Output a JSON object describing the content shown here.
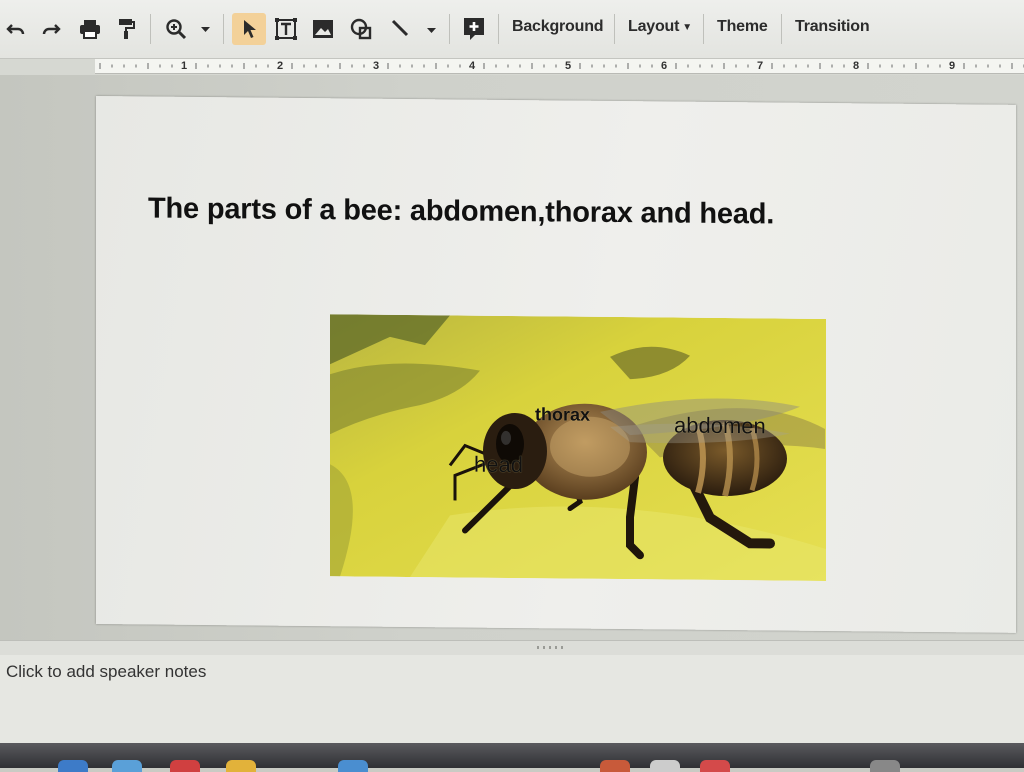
{
  "toolbar": {
    "icons": [
      "undo-icon",
      "redo-icon",
      "print-icon",
      "paint-format-icon",
      "zoom-icon",
      "select-icon",
      "text-box-icon",
      "image-icon",
      "shape-icon",
      "line-icon",
      "new-comment-icon"
    ],
    "background_label": "Background",
    "layout_label": "Layout",
    "theme_label": "Theme",
    "transition_label": "Transition"
  },
  "ruler": {
    "numbers": [
      "1",
      "2",
      "3",
      "4",
      "5",
      "6",
      "7",
      "8",
      "9"
    ]
  },
  "slide": {
    "title": "The parts of a bee: abdomen,thorax and head.",
    "image_labels": {
      "thorax": "thorax",
      "abdomen": "abdomen",
      "head": "head"
    }
  },
  "notes": {
    "placeholder": "Click to add speaker notes"
  },
  "colors": {
    "accent_active_tool": "#f3d199",
    "image_background": "#d9cf3a"
  }
}
